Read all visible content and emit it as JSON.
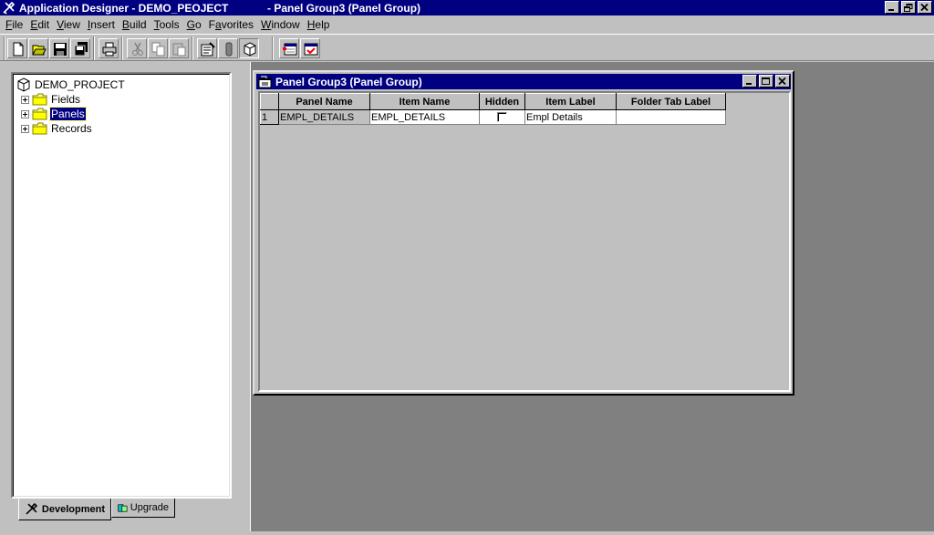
{
  "window": {
    "app_title": "Application Designer - DEMO_PEOJECT",
    "doc_title": "- Panel Group3 (Panel Group)"
  },
  "menubar": [
    {
      "label": "File",
      "key": "F"
    },
    {
      "label": "Edit",
      "key": "E"
    },
    {
      "label": "View",
      "key": "V"
    },
    {
      "label": "Insert",
      "key": "I"
    },
    {
      "label": "Build",
      "key": "B"
    },
    {
      "label": "Tools",
      "key": "T"
    },
    {
      "label": "Go",
      "key": "G"
    },
    {
      "label": "Favorites",
      "key": "a"
    },
    {
      "label": "Window",
      "key": "W"
    },
    {
      "label": "Help",
      "key": "H"
    }
  ],
  "toolbar": {
    "icons": [
      "new-icon",
      "open-icon",
      "save-icon",
      "save-all-icon",
      "print-icon",
      "cut-icon",
      "copy-icon",
      "paste-icon",
      "properties-icon",
      "find-icon",
      "project-icon",
      "insert-panel-icon",
      "validate-icon"
    ]
  },
  "tree": {
    "root": "DEMO_PROJECT",
    "nodes": [
      {
        "label": "Fields",
        "selected": false
      },
      {
        "label": "Panels",
        "selected": true
      },
      {
        "label": "Records",
        "selected": false
      }
    ]
  },
  "tabs": [
    {
      "label": "Development",
      "active": true
    },
    {
      "label": "Upgrade",
      "active": false
    }
  ],
  "child_window": {
    "title": "Panel Group3 (Panel Group)",
    "columns": [
      "Panel Name",
      "Item Name",
      "Hidden",
      "Item Label",
      "Folder Tab Label"
    ],
    "rows": [
      {
        "num": "1",
        "panel_name": "EMPL_DETAILS",
        "item_name": "EMPL_DETAILS",
        "hidden": false,
        "item_label": "Empl Details",
        "folder_tab_label": ""
      }
    ]
  }
}
